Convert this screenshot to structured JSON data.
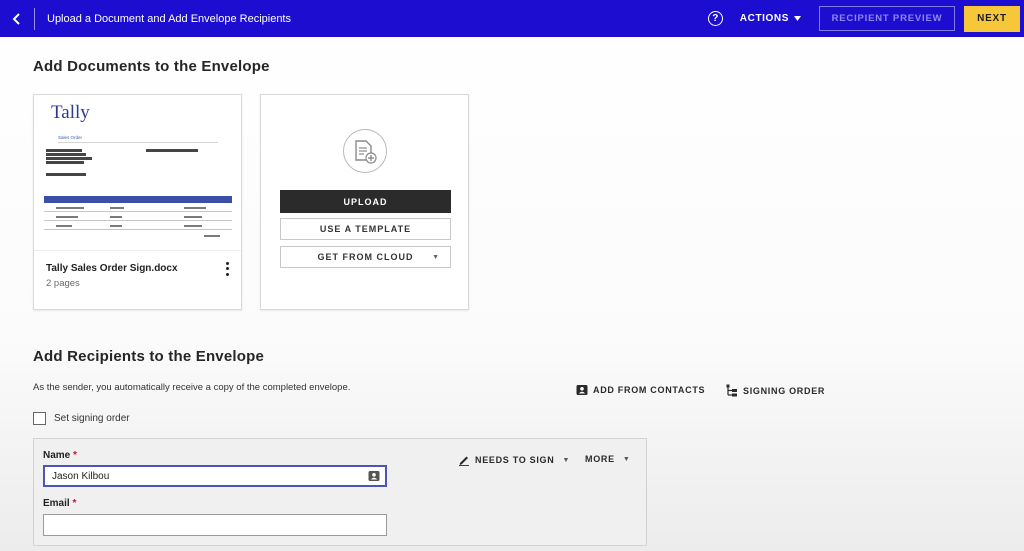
{
  "header": {
    "back_icon": "chevron-left-icon",
    "title": "Upload a Document and Add Envelope Recipients",
    "help_icon": "question-circle-icon",
    "actions_label": "ACTIONS",
    "preview_label": "RECIPIENT PREVIEW",
    "next_label": "NEXT",
    "colors": {
      "bar": "#1c0dd0",
      "next": "#f7c73a"
    }
  },
  "documents": {
    "heading": "Add Documents to the Envelope",
    "items": [
      {
        "name": "Tally Sales Order Sign.docx",
        "pages": "2 pages",
        "thumb_logo": "Tally",
        "thumb_subtitle": "Sales Order"
      }
    ],
    "upload": {
      "upload_label": "UPLOAD",
      "template_label": "USE A TEMPLATE",
      "cloud_label": "GET FROM CLOUD"
    }
  },
  "recipients": {
    "heading": "Add Recipients to the Envelope",
    "sender_note": "As the sender, you automatically receive a copy of the completed envelope.",
    "add_from_contacts": "ADD FROM CONTACTS",
    "signing_order": "SIGNING ORDER",
    "set_signing_order": "Set signing order",
    "card": {
      "name_label": "Name",
      "name_value": "Jason Kilbou",
      "email_label": "Email",
      "email_value": "",
      "required_mark": "*",
      "role_label": "NEEDS TO SIGN",
      "more_label": "MORE"
    }
  }
}
